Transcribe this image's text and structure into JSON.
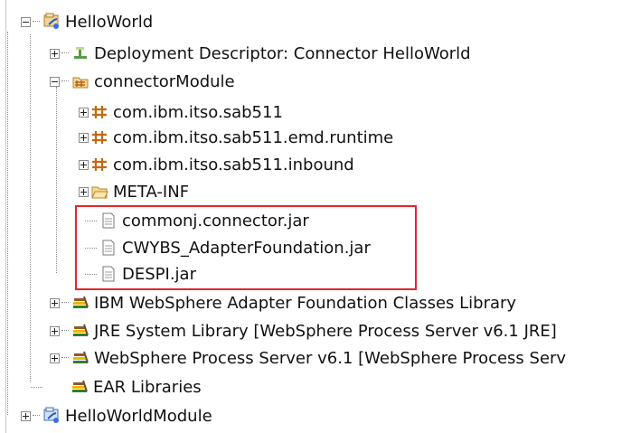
{
  "tree": {
    "project": {
      "label": "HelloWorld",
      "icon": "connector-project-icon"
    },
    "deployment_descriptor": {
      "label": "Deployment Descriptor: Connector HelloWorld",
      "icon": "deployment-descriptor-icon"
    },
    "connector_module": {
      "label": "connectorModule",
      "icon": "source-folder-icon"
    },
    "packages": [
      {
        "label": "com.ibm.itso.sab511",
        "icon": "package-icon"
      },
      {
        "label": "com.ibm.itso.sab511.emd.runtime",
        "icon": "package-icon"
      },
      {
        "label": "com.ibm.itso.sab511.inbound",
        "icon": "package-icon"
      },
      {
        "label": "META-INF",
        "icon": "folder-icon"
      }
    ],
    "jar_files": [
      {
        "label": "commonj.connector.jar",
        "icon": "file-icon"
      },
      {
        "label": "CWYBS_AdapterFoundation.jar",
        "icon": "file-icon"
      },
      {
        "label": "DESPI.jar",
        "icon": "file-icon"
      }
    ],
    "libraries": [
      {
        "label": "IBM WebSphere Adapter Foundation Classes Library",
        "icon": "library-icon"
      },
      {
        "label": "JRE System Library [WebSphere Process Server v6.1 JRE]",
        "icon": "library-icon"
      },
      {
        "label": "WebSphere Process Server v6.1 [WebSphere Process Serv",
        "icon": "library-icon"
      },
      {
        "label": "EAR Libraries",
        "icon": "library-icon"
      }
    ],
    "module": {
      "label": "HelloWorldModule",
      "icon": "module-project-icon"
    }
  },
  "colors": {
    "highlight_border": "#e3262a",
    "tree_lines": "#8a8a8a"
  }
}
